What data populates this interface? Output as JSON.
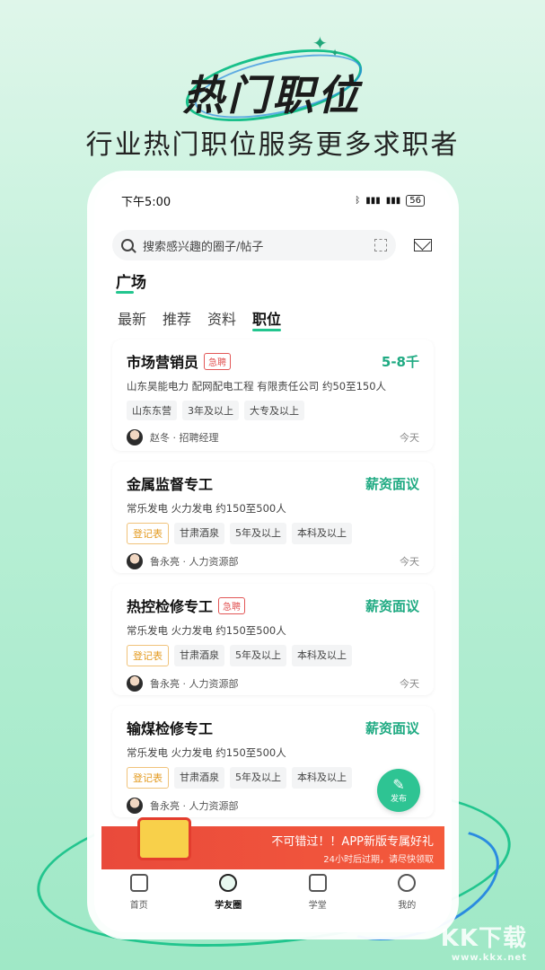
{
  "hero": {
    "title": "热门职位",
    "subtitle": "行业热门职位服务更多求职者"
  },
  "status_bar": {
    "time": "下午5:00",
    "battery": "56"
  },
  "search": {
    "placeholder": "搜索感兴趣的圈子/帖子"
  },
  "section_title": "广场",
  "tabs": [
    "最新",
    "推荐",
    "资料",
    "职位"
  ],
  "active_tab": "职位",
  "jobs": [
    {
      "title": "市场营销员",
      "urgent": "急聘",
      "salary": "5-8千",
      "company": "山东昊能电力 配网配电工程 有限责任公司 约50至150人",
      "tags": [
        "山东东营",
        "3年及以上",
        "大专及以上"
      ],
      "poster": "赵冬 · 招聘经理",
      "time": "今天"
    },
    {
      "title": "金属监督专工",
      "salary": "薪资面议",
      "company": "常乐发电 火力发电 约150至500人",
      "reg_tag": "登记表",
      "tags": [
        "甘肃酒泉",
        "5年及以上",
        "本科及以上"
      ],
      "poster": "鲁永亮 · 人力资源部",
      "time": "今天"
    },
    {
      "title": "热控检修专工",
      "urgent": "急聘",
      "salary": "薪资面议",
      "company": "常乐发电 火力发电 约150至500人",
      "reg_tag": "登记表",
      "tags": [
        "甘肃酒泉",
        "5年及以上",
        "本科及以上"
      ],
      "poster": "鲁永亮 · 人力资源部",
      "time": "今天"
    },
    {
      "title": "输煤检修专工",
      "salary": "薪资面议",
      "company": "常乐发电 火力发电 约150至500人",
      "reg_tag": "登记表",
      "tags": [
        "甘肃酒泉",
        "5年及以上",
        "本科及以上"
      ],
      "poster": "鲁永亮 · 人力资源部"
    }
  ],
  "fab": {
    "label": "发布"
  },
  "banner": {
    "headline": "不可错过！！APP新版专属好礼",
    "sub": "24小时后过期，请尽快领取"
  },
  "nav": [
    "首页",
    "学友圈",
    "学堂",
    "我的"
  ],
  "watermark": {
    "brand": "KK下载",
    "url": "www.kkx.net"
  },
  "colors": {
    "accent": "#22c58e",
    "salary": "#1faa82",
    "urgent": "#e25656",
    "banner": "#e94a3b"
  }
}
